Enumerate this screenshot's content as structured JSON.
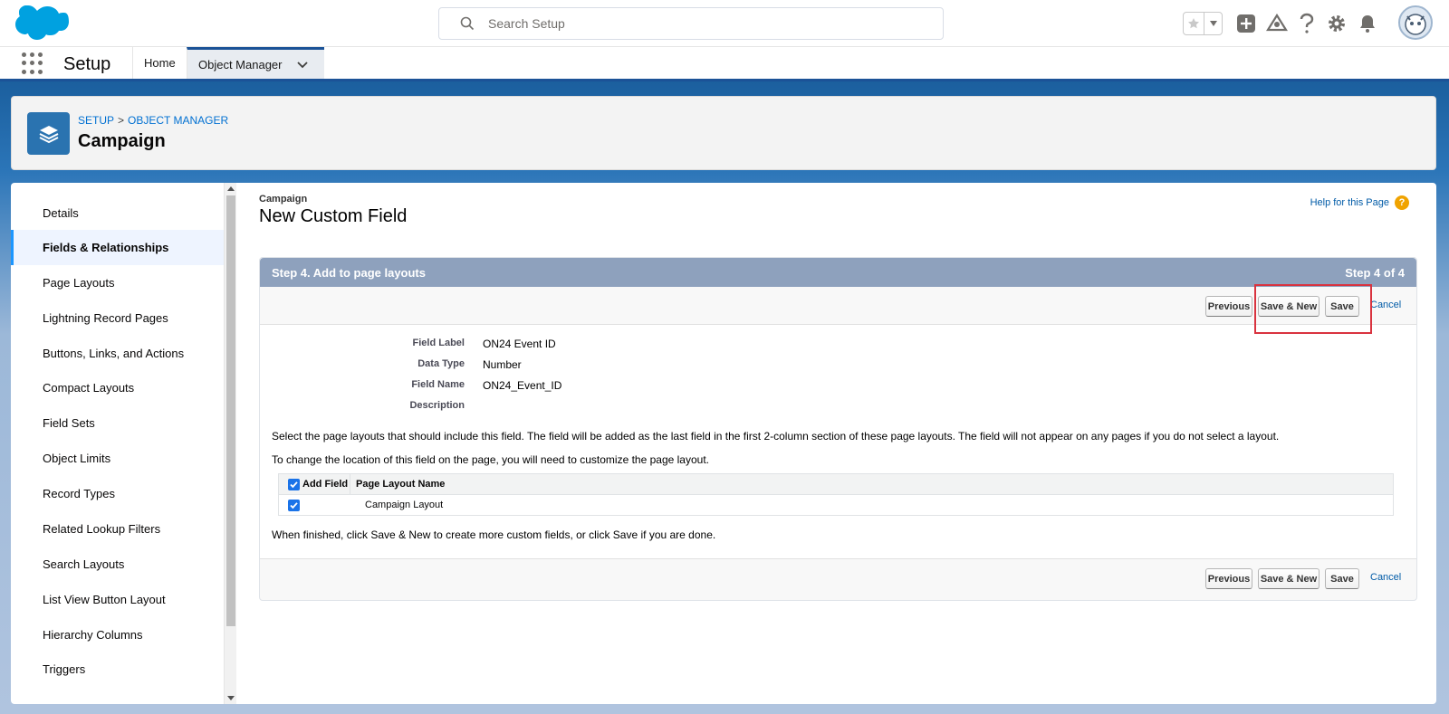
{
  "header": {
    "search_placeholder": "Search Setup"
  },
  "nav": {
    "app_name": "Setup",
    "tabs": [
      {
        "label": "Home"
      },
      {
        "label": "Object Manager"
      }
    ]
  },
  "page_header": {
    "breadcrumb": [
      "SETUP",
      "OBJECT MANAGER"
    ],
    "breadcrumb_sep": ">",
    "title": "Campaign"
  },
  "sidebar": {
    "items": [
      {
        "label": "Details"
      },
      {
        "label": "Fields & Relationships",
        "active": true
      },
      {
        "label": "Page Layouts"
      },
      {
        "label": "Lightning Record Pages"
      },
      {
        "label": "Buttons, Links, and Actions"
      },
      {
        "label": "Compact Layouts"
      },
      {
        "label": "Field Sets"
      },
      {
        "label": "Object Limits"
      },
      {
        "label": "Record Types"
      },
      {
        "label": "Related Lookup Filters"
      },
      {
        "label": "Search Layouts"
      },
      {
        "label": "List View Button Layout"
      },
      {
        "label": "Hierarchy Columns"
      },
      {
        "label": "Triggers"
      }
    ]
  },
  "content": {
    "object_name": "Campaign",
    "title": "New Custom Field",
    "help_link": "Help for this Page",
    "help_icon_glyph": "?",
    "step_title": "Step 4. Add to page layouts",
    "step_counter": "Step 4 of 4",
    "buttons": {
      "previous": "Previous",
      "save_new": "Save & New",
      "save": "Save",
      "cancel": "Cancel"
    },
    "fields": [
      {
        "label": "Field Label",
        "value": "ON24 Event ID"
      },
      {
        "label": "Data Type",
        "value": "Number"
      },
      {
        "label": "Field Name",
        "value": "ON24_Event_ID"
      },
      {
        "label": "Description",
        "value": ""
      }
    ],
    "instruction_1": "Select the page layouts that should include this field. The field will be added as the last field in the first 2-column section of these page layouts. The field will not appear on any pages if you do not select a layout.",
    "instruction_2": "To change the location of this field on the page, you will need to customize the page layout.",
    "table": {
      "col_add": "Add Field",
      "col_name": "Page Layout Name",
      "rows": [
        {
          "checked": true,
          "name": "Campaign Layout"
        }
      ]
    },
    "finish_text": "When finished, click Save & New to create more custom fields, or click Save if you are done."
  },
  "colors": {
    "brand_blue": "#1b5297",
    "link": "#015ba7",
    "step_bar": "#8ea1bd",
    "highlight": "#d9333f"
  }
}
